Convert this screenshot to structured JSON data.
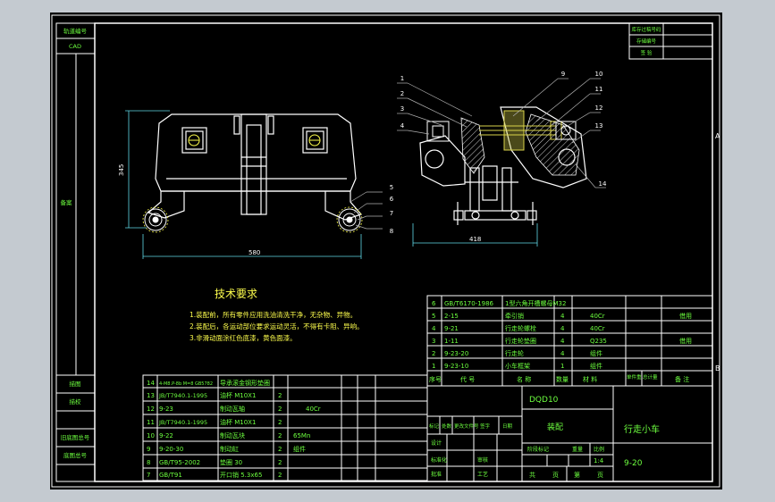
{
  "colors": {
    "background": "#c4cad0",
    "paper": "#000000",
    "frame": "#ffffff",
    "outline": "#ffffff",
    "text_green": "#6dff3f",
    "text_yellow": "#ffff4d",
    "text_cyan": "#4df2ff",
    "dim_cyan": "#5fd9e6",
    "leader_gray": "#b0b0b0",
    "part_yellow": "#d8d24a",
    "hatch_white": "#cfcfcf"
  },
  "left_sidebar": {
    "labels": [
      "轨道编号",
      "CAD",
      "备案",
      "描图",
      "描校",
      "旧底图总号",
      "底图总号"
    ]
  },
  "top_right_box": {
    "rows": [
      "库存过稿号码",
      "存储编号",
      "签 验"
    ]
  },
  "zone_letters": {
    "a": "A",
    "b": "B"
  },
  "dimensions": {
    "height_left": "345",
    "width_left": "580",
    "width_right": "418"
  },
  "balloons": [
    "1",
    "2",
    "3",
    "4",
    "5",
    "6",
    "7",
    "8",
    "9",
    "10",
    "11",
    "12",
    "13",
    "14"
  ],
  "tech_req": {
    "title": "技术要求",
    "lines": [
      "1.装配前，所有零件应用洗油清洗干净，无杂物、异物。",
      "2.装配后，各运动部位要求运动灵活，不得有卡阻、异响。",
      "3.非滑动面涂红色底漆，黄色面漆。"
    ]
  },
  "bom_top": {
    "rows": [
      [
        "6",
        "GB/T6170-1986",
        "1型六角开槽螺母M32",
        "",
        "",
        "",
        ""
      ],
      [
        "5",
        "2-15",
        "牵引销",
        "4",
        "40Cr",
        "",
        "借用"
      ],
      [
        "4",
        "9-21",
        "行走轮螺栓",
        "4",
        "40Cr",
        "",
        ""
      ],
      [
        "3",
        "1-11",
        "行走轮垫圈",
        "4",
        "Q235",
        "",
        "借用"
      ],
      [
        "2",
        "9-23-20",
        "行走轮",
        "4",
        "组件",
        "",
        ""
      ],
      [
        "1",
        "9-23-10",
        "小车框架",
        "1",
        "组件",
        "",
        ""
      ]
    ],
    "header": [
      "序号",
      "代  号",
      "名  称",
      "数量",
      "材  料",
      "单件重",
      "总计量",
      "备  注"
    ]
  },
  "bom_left": {
    "rows": [
      [
        "14",
        "4-M8.P-8b M=8 GB5782",
        "导承滚金钢形垫圈",
        "",
        ""
      ],
      [
        "13",
        "JB/T7940.1-1995",
        "油杯 M10X1",
        "2",
        ""
      ],
      [
        "12",
        "9-23",
        "制动瓦轴",
        "2",
        "40Cr"
      ],
      [
        "11",
        "JB/T7940.1-1995",
        "油杯 M10X1",
        "2",
        ""
      ],
      [
        "10",
        "9-22",
        "制动瓦块",
        "2",
        "65Mn"
      ],
      [
        "9",
        "9-20-30",
        "制动缸",
        "2",
        "组件"
      ],
      [
        "8",
        "GB/T95-2002",
        "垫圈 30",
        "2",
        ""
      ],
      [
        "7",
        "GB/T91",
        "开口销 5.3x65",
        "2",
        ""
      ]
    ]
  },
  "title_block": {
    "code": "DQD10",
    "type": "装配",
    "name": "行走小车",
    "drawing_no": "9-20",
    "scale": "1:4",
    "left_header": [
      "标记",
      "处数",
      "更改文件号",
      "签字",
      "日期"
    ],
    "rev_labels": [
      "设计",
      "审核",
      "工艺",
      "标准化",
      "批准"
    ],
    "stage_header": [
      "阶段标记",
      "重量",
      "比例"
    ],
    "sheet_labels": [
      "共",
      "页",
      "第",
      "页"
    ]
  }
}
